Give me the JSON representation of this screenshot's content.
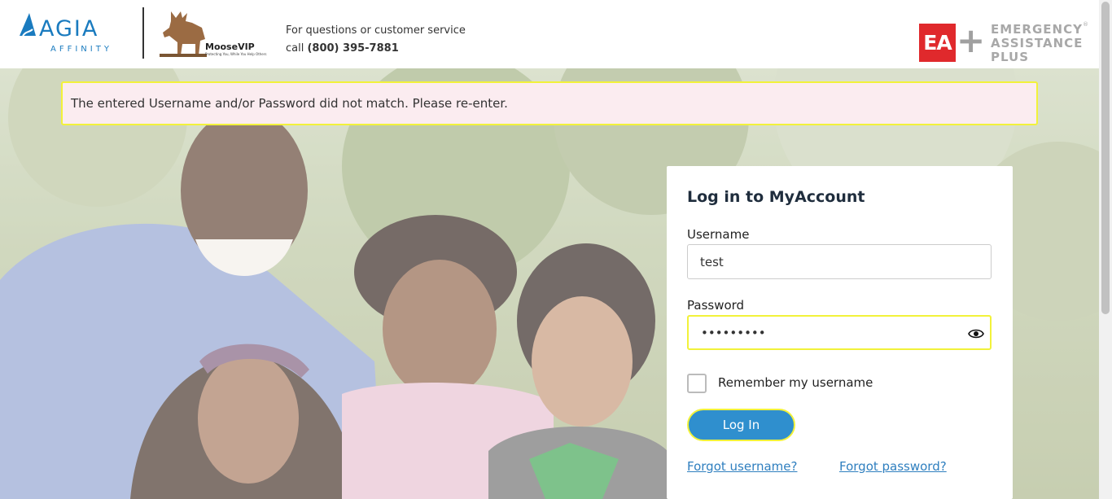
{
  "header": {
    "agia_logo": {
      "name": "AGIA",
      "sub": "AFFINITY"
    },
    "moose_logo": {
      "name": "MooseVIP",
      "tagline": "Protecting You, While You Help Others"
    },
    "contact": {
      "line1": "For questions or customer service",
      "call_prefix": "call ",
      "phone": "(800) 395-7881"
    },
    "ea_logo": {
      "mark": "EA",
      "plus": "+",
      "line1": "EMERGENCY",
      "line2": "ASSISTANCE",
      "line3": "PLUS",
      "reg": "®"
    }
  },
  "alert": {
    "message": "The entered Username and/or Password did not match. Please re-enter."
  },
  "login": {
    "title": "Log in to MyAccount",
    "username_label": "Username",
    "username_value": "test",
    "password_label": "Password",
    "password_value": "•••••••••",
    "remember_label": "Remember my username",
    "remember_checked": false,
    "submit_label": "Log In",
    "forgot_username": "Forgot username?",
    "forgot_password": "Forgot password?"
  },
  "colors": {
    "accent": "#2f8fce",
    "alert_bg": "#fbecf0",
    "focus_outline": "#f2f23a",
    "ea_red": "#e0292c",
    "agia_blue": "#1a7bbf"
  },
  "icons": [
    "agia-drop-icon",
    "moose-icon",
    "eye-icon",
    "checkbox-icon"
  ]
}
